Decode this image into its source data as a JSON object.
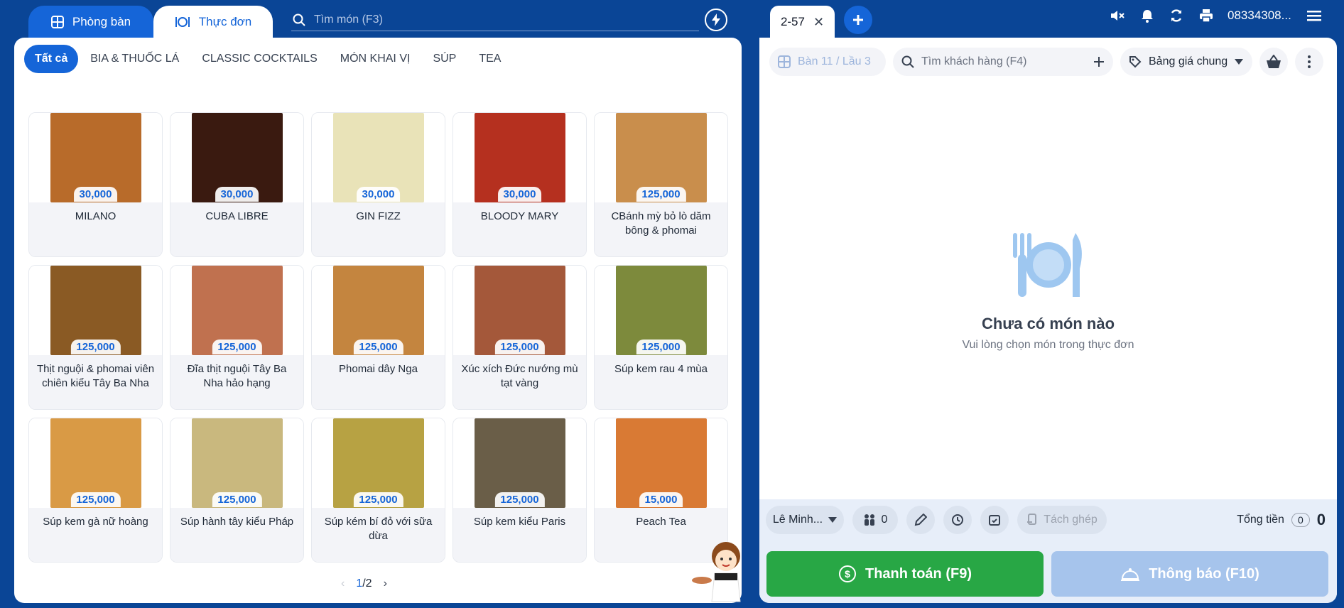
{
  "topnav": {
    "tab_rooms": "Phòng bàn",
    "tab_menu": "Thực đơn",
    "search_placeholder": "Tìm món (F3)"
  },
  "categories": [
    "Tất cả",
    "BIA & THUỐC LÁ",
    "CLASSIC COCKTAILS",
    "MÓN KHAI VỊ",
    "SÚP",
    "TEA"
  ],
  "items": [
    {
      "name": "MILANO",
      "price": "30,000",
      "color": "#b86b2a"
    },
    {
      "name": "CUBA LIBRE",
      "price": "30,000",
      "color": "#3a1a10"
    },
    {
      "name": "GIN FIZZ",
      "price": "30,000",
      "color": "#e9e3b8"
    },
    {
      "name": "BLOODY MARY",
      "price": "30,000",
      "color": "#b5301f"
    },
    {
      "name": "CBánh mỳ bỏ lò dăm bông & phomai",
      "price": "125,000",
      "color": "#c98e4c"
    },
    {
      "name": "Thịt nguội & phomai viên chiên kiểu Tây Ba Nha",
      "price": "125,000",
      "color": "#8a5a24"
    },
    {
      "name": "Đĩa thịt nguội Tây Ba Nha hảo hạng",
      "price": "125,000",
      "color": "#c0714f"
    },
    {
      "name": "Phomai dây Nga",
      "price": "125,000",
      "color": "#c4853f"
    },
    {
      "name": "Xúc xích Đức nướng mù tạt vàng",
      "price": "125,000",
      "color": "#a4583a"
    },
    {
      "name": "Súp kem rau 4 mùa",
      "price": "125,000",
      "color": "#7d8a3c"
    },
    {
      "name": "Súp kem gà nữ hoàng",
      "price": "125,000",
      "color": "#d99a45"
    },
    {
      "name": "Súp hành tây kiểu Pháp",
      "price": "125,000",
      "color": "#c9b87e"
    },
    {
      "name": "Súp kém bí đỏ với sữa dừa",
      "price": "125,000",
      "color": "#b7a243"
    },
    {
      "name": "Súp kem kiểu Paris",
      "price": "125,000",
      "color": "#6a5e48"
    },
    {
      "name": "Peach Tea",
      "price": "15,000",
      "color": "#d97a34"
    }
  ],
  "pager": {
    "current": "1",
    "total": "/2"
  },
  "order": {
    "tab_label": "2-57",
    "phone": "08334308...",
    "table": "Bàn 11 / Lầu 3",
    "customer_placeholder": "Tìm khách hàng (F4)",
    "price_list": "Bảng giá chung",
    "empty_title": "Chưa có món nào",
    "empty_sub": "Vui lòng chọn món trong thực đơn",
    "staff": "Lê Minh...",
    "guests": "0",
    "split": "Tách ghép",
    "total_label": "Tổng tiền",
    "total_count": "0",
    "total_sum": "0",
    "pay_label": "Thanh toán (F9)",
    "notify_label": "Thông báo (F10)"
  },
  "colors": {
    "brand": "#1565d8",
    "background": "#0a4596",
    "pay": "#28a745",
    "notify_disabled": "#a6c4ec"
  }
}
